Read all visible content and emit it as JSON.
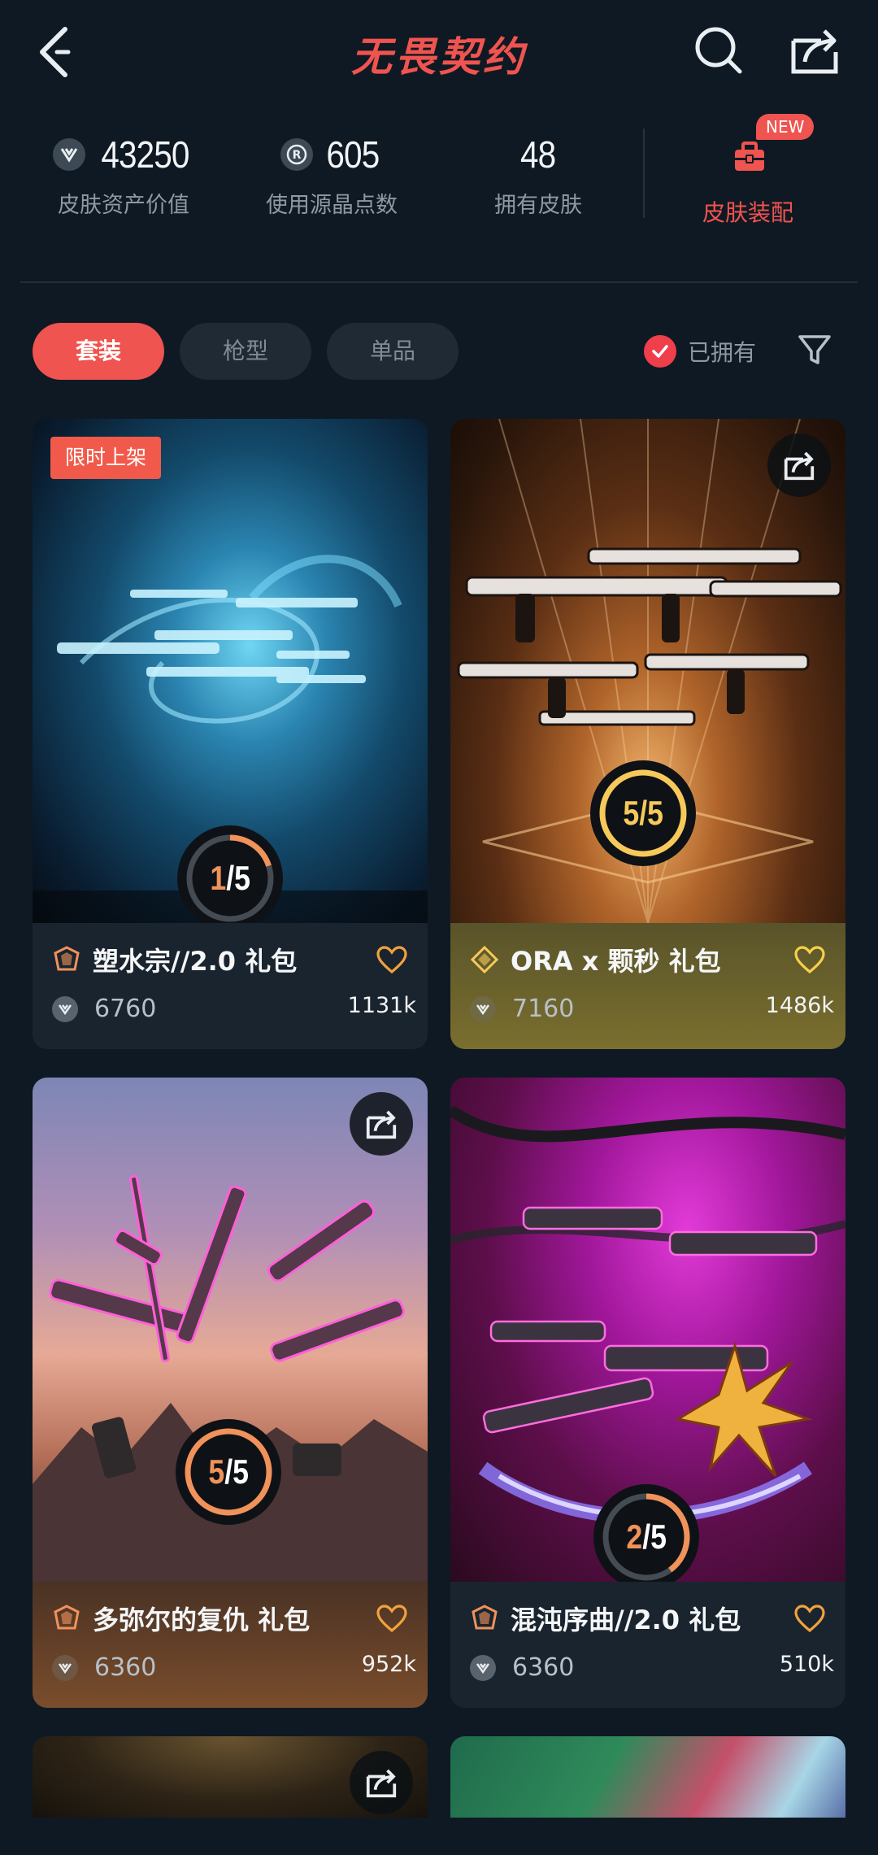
{
  "header": {
    "title": "无畏契约"
  },
  "stats": {
    "asset_value": "43250",
    "asset_value_label": "皮肤资产价值",
    "radianite": "605",
    "radianite_label": "使用源晶点数",
    "owned_skins": "48",
    "owned_skins_label": "拥有皮肤",
    "outfit_label": "皮肤装配",
    "new_badge": "NEW"
  },
  "filters": {
    "tabs": [
      {
        "label": "套装",
        "active": true
      },
      {
        "label": "枪型",
        "active": false
      },
      {
        "label": "单品",
        "active": false
      }
    ],
    "owned_label": "已拥有",
    "owned_checked": true
  },
  "bundles": [
    {
      "name": "塑水宗//2.0 礼包",
      "price": "6760",
      "likes": "1131k",
      "progress_current": "1",
      "progress_total": "5",
      "badge": "限时上架",
      "progress_fraction": 0.2
    },
    {
      "name": "ORA x 颗秒 礼包",
      "price": "7160",
      "likes": "1486k",
      "progress_current": "5",
      "progress_total": "5",
      "badge": "",
      "progress_fraction": 1.0
    },
    {
      "name": "多弥尔的复仇 礼包",
      "price": "6360",
      "likes": "952k",
      "progress_current": "5",
      "progress_total": "5",
      "badge": "",
      "progress_fraction": 1.0
    },
    {
      "name": "混沌序曲//2.0 礼包",
      "price": "6360",
      "likes": "510k",
      "progress_current": "2",
      "progress_total": "5",
      "badge": "",
      "progress_fraction": 0.4
    }
  ],
  "colors": {
    "accent": "#ef5450",
    "background": "#0f1923",
    "progress_orange": "#f0925a",
    "progress_gold": "#f6c95a"
  }
}
